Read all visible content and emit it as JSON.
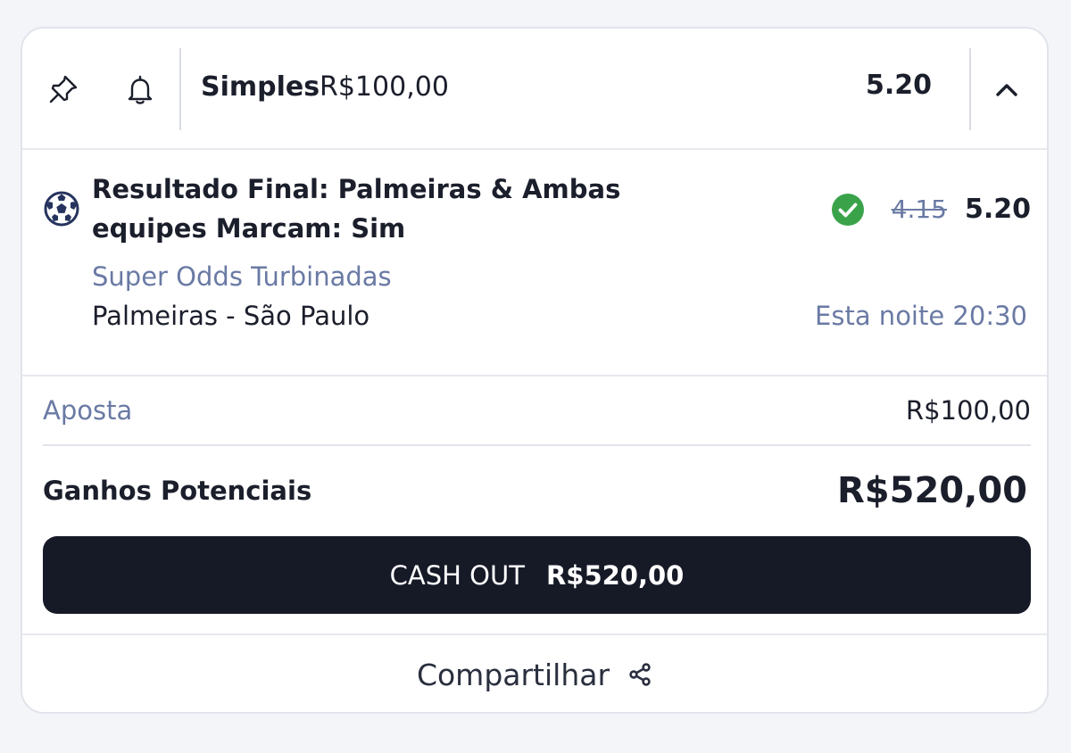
{
  "header": {
    "bet_type": "Simples",
    "stake": "R$100,00",
    "total_odds": "5.20",
    "icons": {
      "pin": "pin-icon",
      "bell": "bell-icon",
      "collapse": "chevron-up-icon"
    }
  },
  "selection": {
    "sport_icon": "soccer-ball-icon",
    "name": "Resultado Final: Palmeiras & Ambas equipes Marcam: Sim",
    "status_icon": "check-circle-icon",
    "old_odds": "4.15",
    "new_odds": "5.20",
    "promo": "Super Odds Turbinadas",
    "event": "Palmeiras - São Paulo",
    "time": "Esta noite 20:30"
  },
  "summary": {
    "stake_label": "Aposta",
    "stake_value": "R$100,00",
    "returns_label": "Ganhos Potenciais",
    "returns_value": "R$520,00"
  },
  "cashout": {
    "label": "CASH OUT",
    "amount": "R$520,00"
  },
  "footer": {
    "share_label": "Compartilhar",
    "share_icon": "share-icon"
  },
  "colors": {
    "background": "#f4f5f9",
    "text_dark": "#1b1e2b",
    "muted_blue": "#6a7aa4",
    "success_green": "#3aa34a",
    "button_dark": "#161a27"
  }
}
